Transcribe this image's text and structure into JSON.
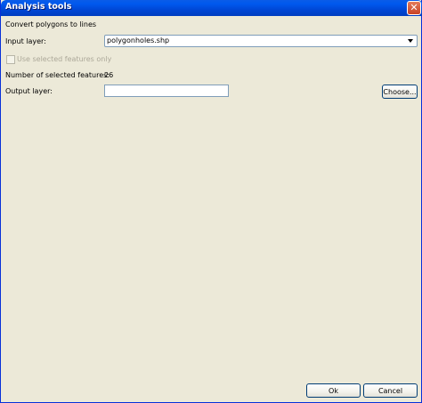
{
  "window": {
    "title": "Analysis tools",
    "close_glyph": "✕"
  },
  "form": {
    "heading": "Convert polygons to lines",
    "input_layer_label": "Input layer:",
    "input_layer_value": "polygonholes.shp",
    "selected_only_label": "Use selected features only",
    "selected_only_checked": false,
    "selected_only_enabled": false,
    "count_label": "Number of selected features:",
    "count_value": "26",
    "output_layer_label": "Output layer:",
    "output_layer_value": "",
    "choose_label": "Choose..."
  },
  "buttons": {
    "ok_label": "Ok",
    "cancel_label": "Cancel"
  },
  "icons": {
    "close": "close-icon",
    "dropdown": "chevron-down-icon"
  }
}
